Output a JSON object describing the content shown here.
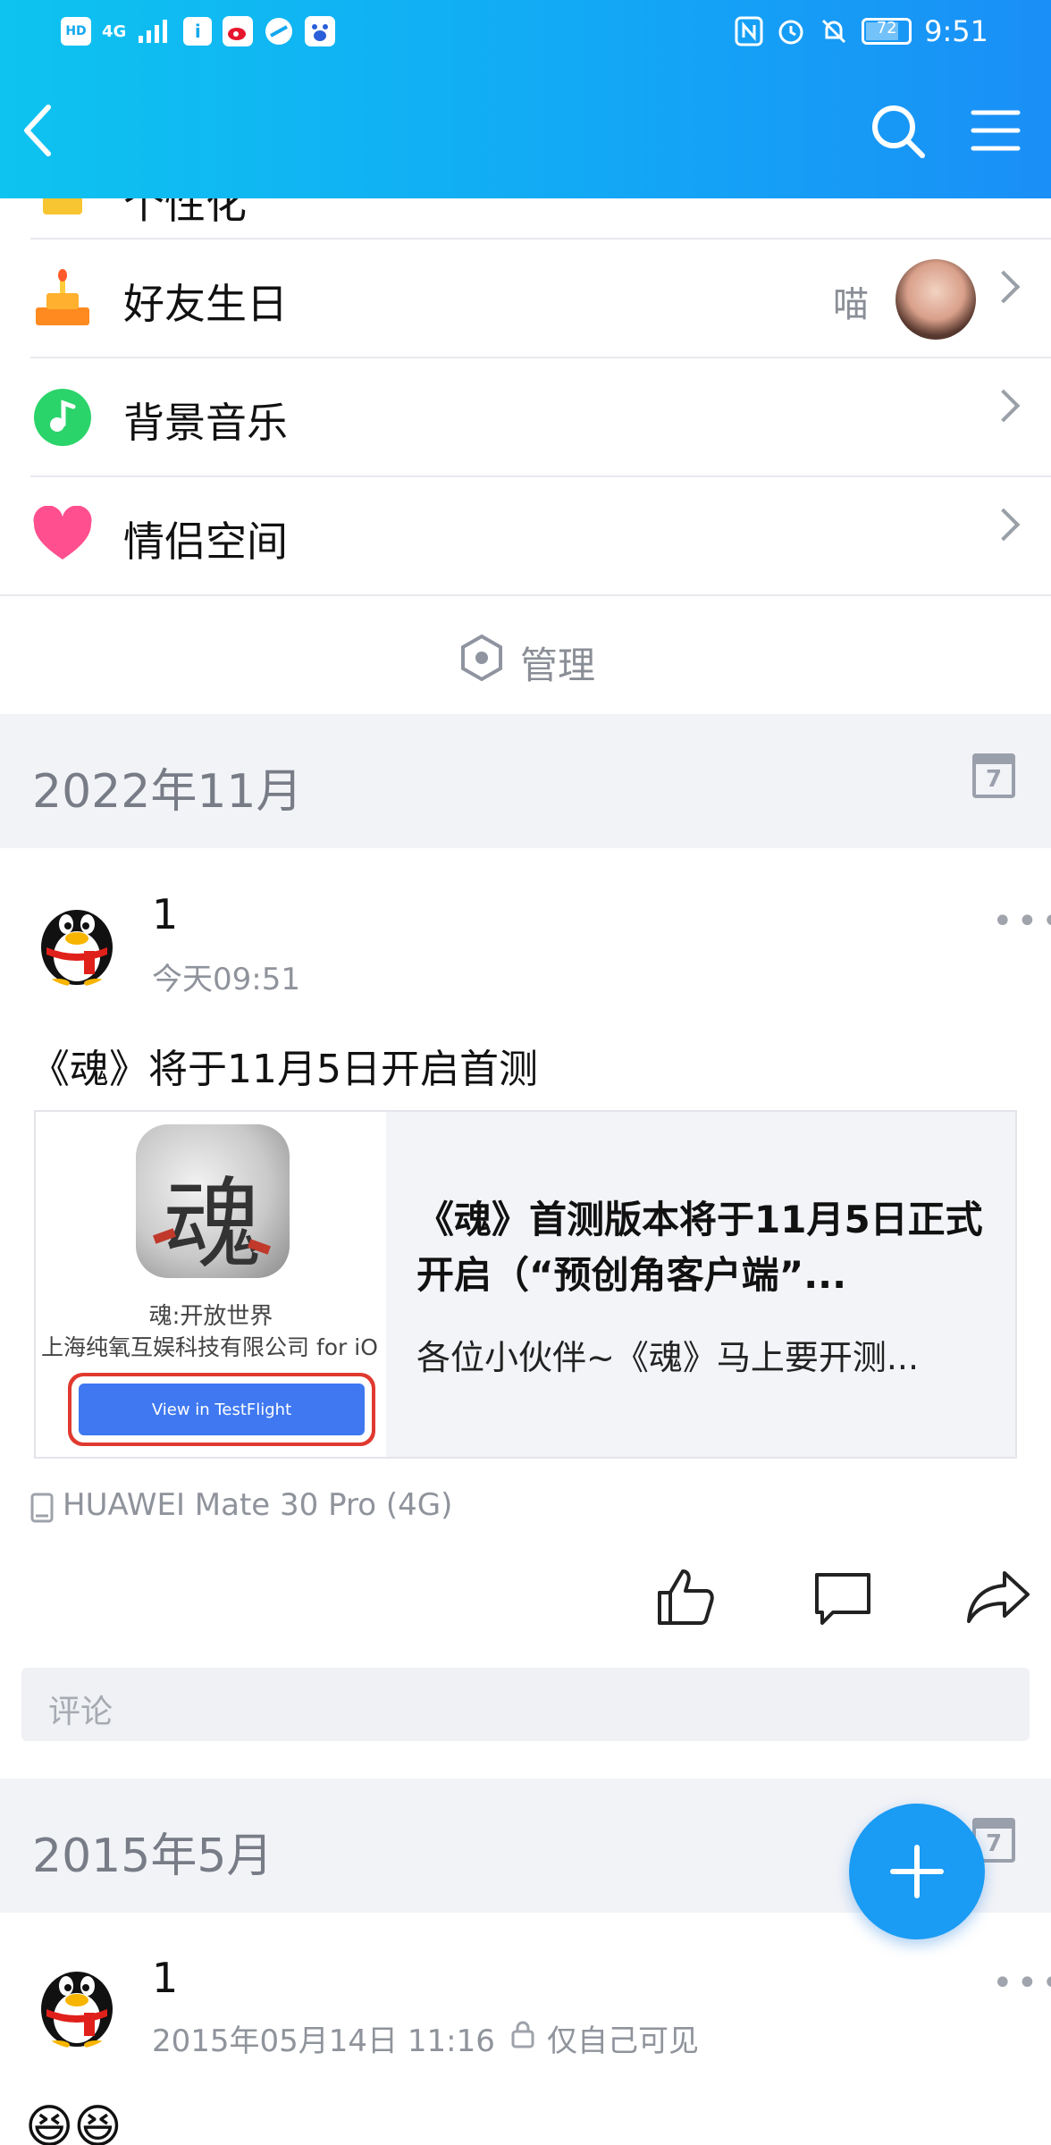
{
  "status_bar": {
    "left_badges": [
      "HD",
      "4G"
    ],
    "battery": "72",
    "time": "9:51"
  },
  "app_bar": {
    "back_icon": "chevron-left-icon",
    "search_icon": "search-icon",
    "menu_icon": "menu-icon"
  },
  "list": {
    "partial_label": "个性化",
    "items": [
      {
        "label": "好友生日",
        "value": "喵",
        "icon": "birthday-cake-icon"
      },
      {
        "label": "背景音乐",
        "value": "",
        "icon": "music-note-icon"
      },
      {
        "label": "情侣空间",
        "value": "",
        "icon": "heart-icon"
      }
    ],
    "manage_label": "管理"
  },
  "sections": [
    {
      "month": "2022年11月",
      "calendar_day": "7",
      "post": {
        "author": "1",
        "time": "今天09:51",
        "text": "《魂》将于11月5日开启首测",
        "card": {
          "app_glyph": "魂",
          "app_name": "魂:开放世界",
          "publisher": "上海纯氧互娱科技有限公司 for iO",
          "button_label": "View in TestFlight",
          "title": "《魂》首测版本将于11月5日正式开启（“预创角客户端”...",
          "summary": "各位小伙伴~《魂》马上要开测..."
        },
        "device": "HUAWEI Mate 30 Pro (4G)",
        "comment_placeholder": "评论"
      }
    },
    {
      "month": "2015年5月",
      "calendar_day": "7",
      "post": {
        "author": "1",
        "time": "2015年05月14日 11:16",
        "visibility": "仅自己可见",
        "emoji": "😆😆"
      }
    }
  ],
  "colors": {
    "accent": "#1a9bf4",
    "header_gradient_start": "#0ec3f0",
    "header_gradient_end": "#1a8ff7",
    "section_bg": "#f2f3f7"
  }
}
